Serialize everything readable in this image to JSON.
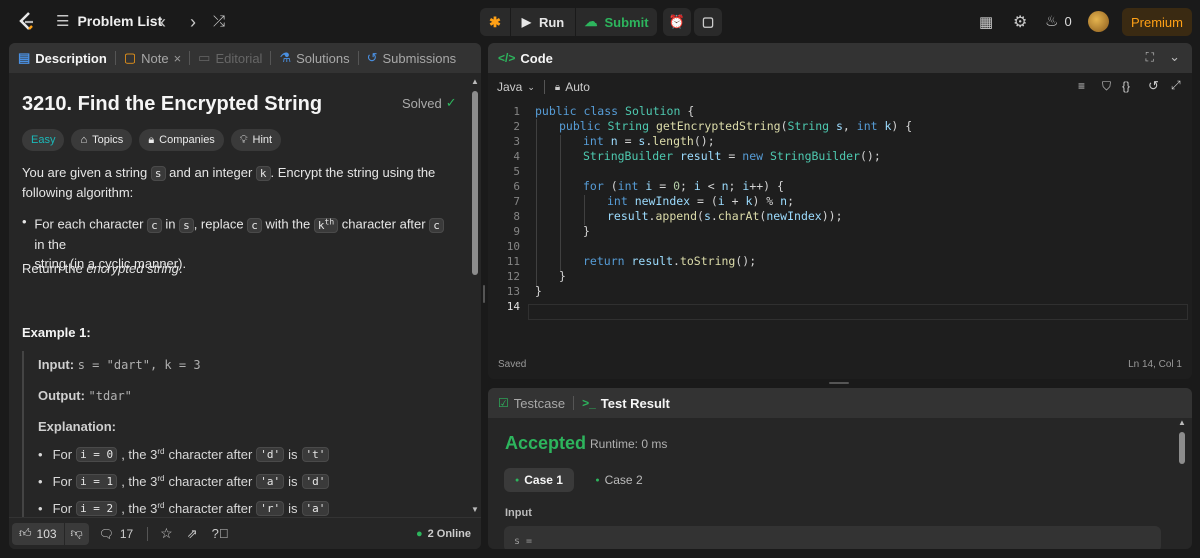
{
  "topbar": {
    "problem_list": "Problem List",
    "run": "Run",
    "submit": "Submit",
    "streak": "0",
    "premium": "Premium"
  },
  "left": {
    "tabs": [
      "Description",
      "Note",
      "Editorial",
      "Solutions",
      "Submissions"
    ],
    "title": "3210. Find the Encrypted String",
    "solved": "Solved",
    "chips": [
      "Easy",
      "Topics",
      "Companies",
      "Hint"
    ],
    "desc_p1_a": "You are given a string",
    "desc_p1_s": "s",
    "desc_p1_b": "and an integer",
    "desc_p1_k": "k",
    "desc_p1_c": ". Encrypt the string using the following",
    "desc_p1_d": "algorithm:",
    "bullet_a": "For each character",
    "bullet_c": "c",
    "bullet_in": "in",
    "bullet_s": "s",
    "bullet_replace": ", replace",
    "bullet_with": "with the",
    "bullet_kth": "k",
    "bullet_th": "th",
    "bullet_after": "character after",
    "bullet_in2": "in the",
    "bullet_line2": "string (in a cyclic manner).",
    "return_a": "Return the",
    "return_b": "encrypted string",
    "return_c": ".",
    "example_title": "Example 1:",
    "input_label": "Input:",
    "input_val": "s = \"dart\", k = 3",
    "output_label": "Output:",
    "output_val": "\"tdar\"",
    "explanation_label": "Explanation:",
    "expl": [
      {
        "pre": "For",
        "code": "i = 0",
        "mid": ", the 3",
        "sup": "rd",
        "mid2": "character after",
        "c1": "'d'",
        "is": "is",
        "c2": "'t'"
      },
      {
        "pre": "For",
        "code": "i = 1",
        "mid": ", the 3",
        "sup": "rd",
        "mid2": "character after",
        "c1": "'a'",
        "is": "is",
        "c2": "'d'"
      },
      {
        "pre": "For",
        "code": "i = 2",
        "mid": ", the 3",
        "sup": "rd",
        "mid2": "character after",
        "c1": "'r'",
        "is": "is",
        "c2": "'a'"
      }
    ],
    "likes": "103",
    "comments": "17",
    "online": "2 Online"
  },
  "code": {
    "title": "Code",
    "language": "Java",
    "auto": "Auto",
    "saved": "Saved",
    "position": "Ln 14, Col 1",
    "line_numbers": [
      "1",
      "2",
      "3",
      "4",
      "5",
      "6",
      "7",
      "8",
      "9",
      "10",
      "11",
      "12",
      "13",
      "14"
    ]
  },
  "result": {
    "tabs": [
      "Testcase",
      "Test Result"
    ],
    "status": "Accepted",
    "runtime": "Runtime: 0 ms",
    "cases": [
      "Case 1",
      "Case 2"
    ],
    "input_label": "Input",
    "input_preview": "s ="
  },
  "colors": {
    "accepted": "#2db55d",
    "submit": "#2db55d",
    "premium": "#ffa116",
    "easy": "#1cb8b8"
  }
}
